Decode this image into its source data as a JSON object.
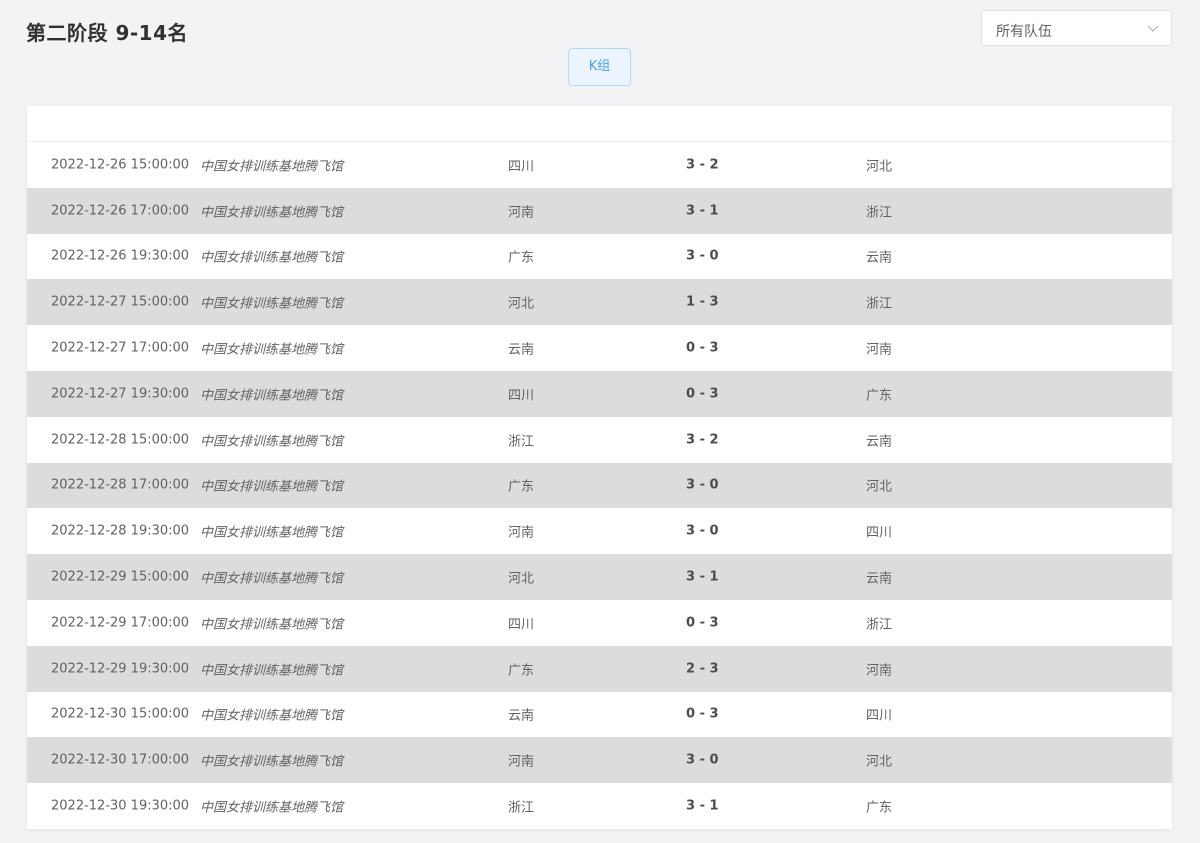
{
  "header": {
    "title": "第二阶段 9-14名",
    "team_filter": {
      "selected": "所有队伍"
    },
    "group_tab": "K组"
  },
  "matches": [
    {
      "time": "2022-12-26 15:00:00",
      "venue": "中国女排训练基地腾飞馆",
      "home": "四川",
      "score": "3 - 2",
      "away": "河北"
    },
    {
      "time": "2022-12-26 17:00:00",
      "venue": "中国女排训练基地腾飞馆",
      "home": "河南",
      "score": "3 - 1",
      "away": "浙江"
    },
    {
      "time": "2022-12-26 19:30:00",
      "venue": "中国女排训练基地腾飞馆",
      "home": "广东",
      "score": "3 - 0",
      "away": "云南"
    },
    {
      "time": "2022-12-27 15:00:00",
      "venue": "中国女排训练基地腾飞馆",
      "home": "河北",
      "score": "1 - 3",
      "away": "浙江"
    },
    {
      "time": "2022-12-27 17:00:00",
      "venue": "中国女排训练基地腾飞馆",
      "home": "云南",
      "score": "0 - 3",
      "away": "河南"
    },
    {
      "time": "2022-12-27 19:30:00",
      "venue": "中国女排训练基地腾飞馆",
      "home": "四川",
      "score": "0 - 3",
      "away": "广东"
    },
    {
      "time": "2022-12-28 15:00:00",
      "venue": "中国女排训练基地腾飞馆",
      "home": "浙江",
      "score": "3 - 2",
      "away": "云南"
    },
    {
      "time": "2022-12-28 17:00:00",
      "venue": "中国女排训练基地腾飞馆",
      "home": "广东",
      "score": "3 - 0",
      "away": "河北"
    },
    {
      "time": "2022-12-28 19:30:00",
      "venue": "中国女排训练基地腾飞馆",
      "home": "河南",
      "score": "3 - 0",
      "away": "四川"
    },
    {
      "time": "2022-12-29 15:00:00",
      "venue": "中国女排训练基地腾飞馆",
      "home": "河北",
      "score": "3 - 1",
      "away": "云南"
    },
    {
      "time": "2022-12-29 17:00:00",
      "venue": "中国女排训练基地腾飞馆",
      "home": "四川",
      "score": "0 - 3",
      "away": "浙江"
    },
    {
      "time": "2022-12-29 19:30:00",
      "venue": "中国女排训练基地腾飞馆",
      "home": "广东",
      "score": "2 - 3",
      "away": "河南"
    },
    {
      "time": "2022-12-30 15:00:00",
      "venue": "中国女排训练基地腾飞馆",
      "home": "云南",
      "score": "0 - 3",
      "away": "四川"
    },
    {
      "time": "2022-12-30 17:00:00",
      "venue": "中国女排训练基地腾飞馆",
      "home": "河南",
      "score": "3 - 0",
      "away": "河北"
    },
    {
      "time": "2022-12-30 19:30:00",
      "venue": "中国女排训练基地腾飞馆",
      "home": "浙江",
      "score": "3 - 1",
      "away": "广东"
    }
  ],
  "colors": {
    "page_bg": "#f2f3f5",
    "row_alt": "#dcdcdc",
    "accent": "#409eff"
  },
  "icons": {
    "select_arrow": "chevron-down-icon"
  }
}
